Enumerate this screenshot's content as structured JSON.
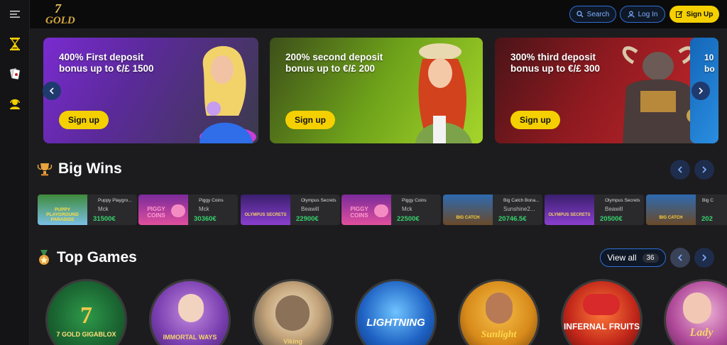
{
  "header": {
    "search_label": "Search",
    "login_label": "Log In",
    "signup_label": "Sign Up"
  },
  "logo_text": "7 GOLD",
  "sidebar": {
    "items": [
      {
        "icon": "menu-icon"
      },
      {
        "icon": "hourglass-icon"
      },
      {
        "icon": "cards-icon"
      },
      {
        "icon": "support-agent-icon"
      }
    ]
  },
  "promos": [
    {
      "line1": "400% First deposit",
      "line2": "bonus up to €/£ 1500",
      "button": "Sign up"
    },
    {
      "line1": "200% second deposit",
      "line2": "bonus up to €/£ 200",
      "button": "Sign up"
    },
    {
      "line1": "300% third deposit",
      "line2": "bonus up to €/£ 300",
      "button": "Sign up"
    },
    {
      "line1": "10",
      "line2": "bo"
    }
  ],
  "big_wins": {
    "title": "Big Wins",
    "items": [
      {
        "game": "Puppy Playgro...",
        "user": "Mck",
        "amount": "31500€",
        "thumb_text": "PUPPY PLAYGROUND PARADISE"
      },
      {
        "game": "Piggy Coins",
        "user": "Mck",
        "amount": "30360€",
        "thumb_text": "PIGGY COINS"
      },
      {
        "game": "Olympus Secrets",
        "user": "Beawill",
        "amount": "22900€",
        "thumb_text": "OLYMPUS SECRETS"
      },
      {
        "game": "Piggy Coins",
        "user": "Mck",
        "amount": "22500€",
        "thumb_text": "PIGGY COINS"
      },
      {
        "game": "Big Catch Bona...",
        "user": "Sunshine2...",
        "amount": "20746.5€",
        "thumb_text": "BIG CATCH"
      },
      {
        "game": "Olympus Secrets",
        "user": "Beawill",
        "amount": "20500€",
        "thumb_text": "OLYMPUS SECRETS"
      },
      {
        "game": "Big C",
        "user": "",
        "amount": "202",
        "thumb_text": "BIG CATCH"
      }
    ]
  },
  "top_games": {
    "title": "Top Games",
    "view_all_label": "View all",
    "view_all_count": "36",
    "items": [
      {
        "name": "7 GOLD GIGABLOX"
      },
      {
        "name": "IMMORTAL WAYS"
      },
      {
        "name": "Viking"
      },
      {
        "name": "LIGHTNING"
      },
      {
        "name": "Sunlight"
      },
      {
        "name": "INFERNAL FRUITS"
      },
      {
        "name": "Lady"
      }
    ]
  },
  "colors": {
    "accent_yellow": "#f5d000",
    "accent_blue": "#2f6fd6",
    "win_green": "#37d36b",
    "background": "#1c1c1e"
  }
}
